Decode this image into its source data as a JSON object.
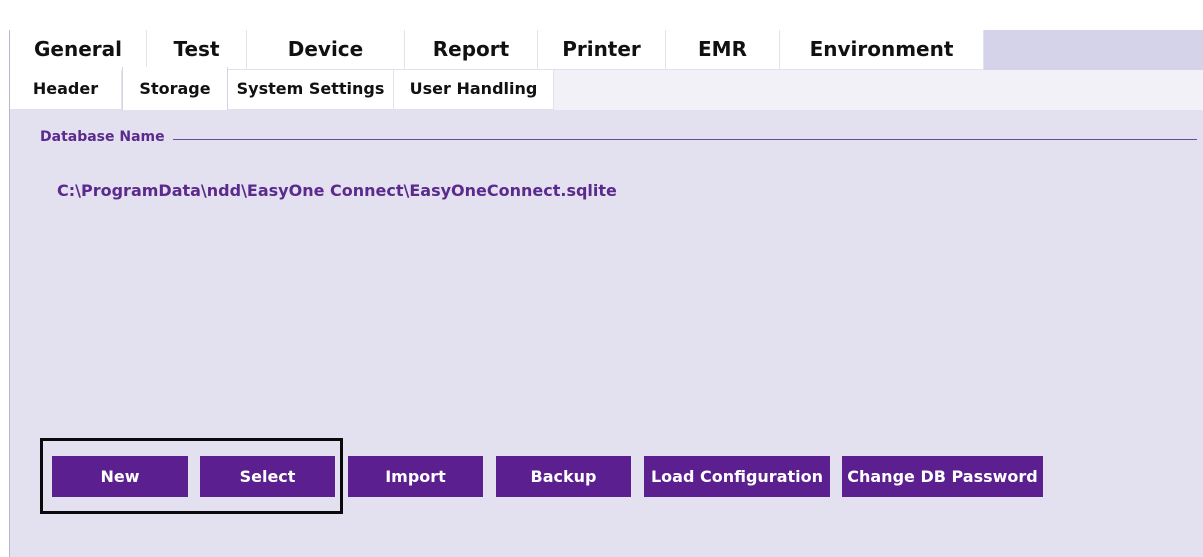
{
  "main_tabs": [
    {
      "label": "General",
      "active": true
    },
    {
      "label": "Test"
    },
    {
      "label": "Device"
    },
    {
      "label": "Report"
    },
    {
      "label": "Printer"
    },
    {
      "label": "EMR"
    },
    {
      "label": "Environment"
    }
  ],
  "sub_tabs": [
    {
      "label": "Header"
    },
    {
      "label": "Storage",
      "active": true
    },
    {
      "label": "System Settings"
    },
    {
      "label": "User Handling"
    }
  ],
  "storage": {
    "group_title": "Database Name",
    "database_path": "C:\\ProgramData\\ndd\\EasyOne Connect\\EasyOneConnect.sqlite"
  },
  "buttons": {
    "new": "New",
    "select": "Select",
    "import": "Import",
    "backup": "Backup",
    "load_configuration": "Load Configuration",
    "change_db_password": "Change DB Password"
  },
  "colors": {
    "accent": "#5c1f8f",
    "panel_background": "#e3e1f0",
    "label_text": "#5b2a8c",
    "highlight_border": "#0a0a0a"
  }
}
